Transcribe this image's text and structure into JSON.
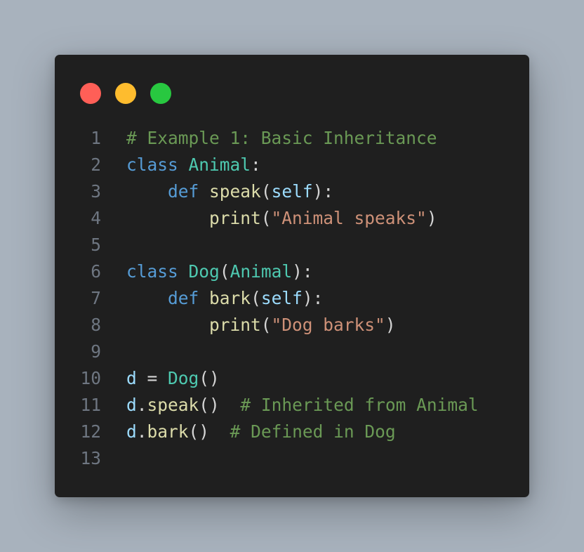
{
  "colors": {
    "background": "#a8b2bd",
    "window": "#1f1f1f",
    "close": "#ff5f57",
    "minimize": "#febc2e",
    "maximize": "#28c840",
    "line_number": "#6e7681",
    "keyword": "#569cd6",
    "class_name": "#4ec9b0",
    "function": "#dcdcaa",
    "parameter": "#9cdcfe",
    "string": "#ce9178",
    "comment": "#6a9955",
    "punctuation": "#d4d4d4"
  },
  "window_controls": [
    "close-dot",
    "minimize-dot",
    "maximize-dot"
  ],
  "code": {
    "lines": [
      {
        "number": "1",
        "tokens": [
          {
            "text": "# Example 1: Basic Inheritance",
            "type": "cmt"
          }
        ]
      },
      {
        "number": "2",
        "tokens": [
          {
            "text": "class",
            "type": "kw"
          },
          {
            "text": " ",
            "type": "p"
          },
          {
            "text": "Animal",
            "type": "cls"
          },
          {
            "text": ":",
            "type": "p"
          }
        ]
      },
      {
        "number": "3",
        "tokens": [
          {
            "text": "    ",
            "type": "p"
          },
          {
            "text": "def",
            "type": "kw"
          },
          {
            "text": " ",
            "type": "p"
          },
          {
            "text": "speak",
            "type": "fn"
          },
          {
            "text": "(",
            "type": "p"
          },
          {
            "text": "self",
            "type": "param"
          },
          {
            "text": "):",
            "type": "p"
          }
        ]
      },
      {
        "number": "4",
        "tokens": [
          {
            "text": "        ",
            "type": "p"
          },
          {
            "text": "print",
            "type": "fn"
          },
          {
            "text": "(",
            "type": "p"
          },
          {
            "text": "\"Animal speaks\"",
            "type": "str"
          },
          {
            "text": ")",
            "type": "p"
          }
        ]
      },
      {
        "number": "5",
        "tokens": []
      },
      {
        "number": "6",
        "tokens": [
          {
            "text": "class",
            "type": "kw"
          },
          {
            "text": " ",
            "type": "p"
          },
          {
            "text": "Dog",
            "type": "cls"
          },
          {
            "text": "(",
            "type": "p"
          },
          {
            "text": "Animal",
            "type": "cls"
          },
          {
            "text": "):",
            "type": "p"
          }
        ]
      },
      {
        "number": "7",
        "tokens": [
          {
            "text": "    ",
            "type": "p"
          },
          {
            "text": "def",
            "type": "kw"
          },
          {
            "text": " ",
            "type": "p"
          },
          {
            "text": "bark",
            "type": "fn"
          },
          {
            "text": "(",
            "type": "p"
          },
          {
            "text": "self",
            "type": "param"
          },
          {
            "text": "):",
            "type": "p"
          }
        ]
      },
      {
        "number": "8",
        "tokens": [
          {
            "text": "        ",
            "type": "p"
          },
          {
            "text": "print",
            "type": "fn"
          },
          {
            "text": "(",
            "type": "p"
          },
          {
            "text": "\"Dog barks\"",
            "type": "str"
          },
          {
            "text": ")",
            "type": "p"
          }
        ]
      },
      {
        "number": "9",
        "tokens": []
      },
      {
        "number": "10",
        "tokens": [
          {
            "text": "d",
            "type": "param"
          },
          {
            "text": " = ",
            "type": "p"
          },
          {
            "text": "Dog",
            "type": "cls"
          },
          {
            "text": "()",
            "type": "p"
          }
        ]
      },
      {
        "number": "11",
        "tokens": [
          {
            "text": "d",
            "type": "param"
          },
          {
            "text": ".",
            "type": "p"
          },
          {
            "text": "speak",
            "type": "fn"
          },
          {
            "text": "()  ",
            "type": "p"
          },
          {
            "text": "# Inherited from Animal",
            "type": "cmt"
          }
        ]
      },
      {
        "number": "12",
        "tokens": [
          {
            "text": "d",
            "type": "param"
          },
          {
            "text": ".",
            "type": "p"
          },
          {
            "text": "bark",
            "type": "fn"
          },
          {
            "text": "()  ",
            "type": "p"
          },
          {
            "text": "# Defined in Dog",
            "type": "cmt"
          }
        ]
      },
      {
        "number": "13",
        "tokens": []
      }
    ]
  }
}
